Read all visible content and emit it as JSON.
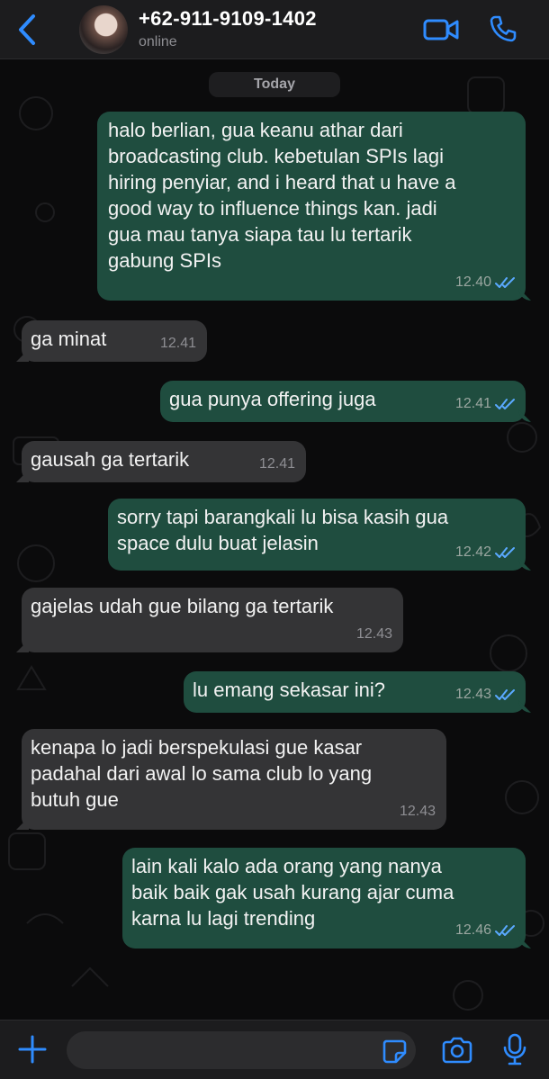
{
  "header": {
    "contact_name": "+62-911-9109-1402",
    "status": "online",
    "icons": [
      "back-chevron-icon",
      "avatar",
      "video-call-icon",
      "phone-call-icon"
    ]
  },
  "chat": {
    "date_label": "Today",
    "messages": [
      {
        "dir": "out",
        "text": "halo berlian, gua keanu athar dari\nbroadcasting club. kebetulan SPIs lagi\nhiring penyiar, and i heard that u have a\ngood way to influence things kan. jadi\ngua mau tanya siapa tau lu tertarik\ngabung SPIs",
        "time": "12.40",
        "read": true
      },
      {
        "dir": "in",
        "text": "ga minat",
        "time": "12.41"
      },
      {
        "dir": "out",
        "text": "gua punya offering juga",
        "time": "12.41",
        "read": true
      },
      {
        "dir": "in",
        "text": "gausah ga tertarik",
        "time": "12.41"
      },
      {
        "dir": "out",
        "text": "sorry tapi barangkali lu bisa kasih gua\nspace dulu buat jelasin",
        "time": "12.42",
        "read": true
      },
      {
        "dir": "in",
        "text": "gajelas udah gue bilang ga tertarik",
        "time": "12.43"
      },
      {
        "dir": "out",
        "text": "lu emang sekasar ini?",
        "time": "12.43",
        "read": true
      },
      {
        "dir": "in",
        "text": "kenapa lo jadi berspekulasi gue kasar\npadahal dari awal lo sama club lo yang\nbutuh gue",
        "time": "12.43"
      },
      {
        "dir": "out",
        "text": "lain kali kalo ada orang yang nanya\nbaik baik gak usah kurang ajar cuma\nkarna lu lagi trending",
        "time": "12.46",
        "read": true
      }
    ]
  },
  "composer": {
    "input_value": "",
    "icons": [
      "plus-icon",
      "sticker-icon",
      "camera-icon",
      "microphone-icon"
    ]
  },
  "colors": {
    "accent": "#2f8cff",
    "outgoing_bubble": "#1f4d3f",
    "incoming_bubble": "#343436",
    "background": "#0b0b0c",
    "read_ticks": "#5aa9ff"
  }
}
